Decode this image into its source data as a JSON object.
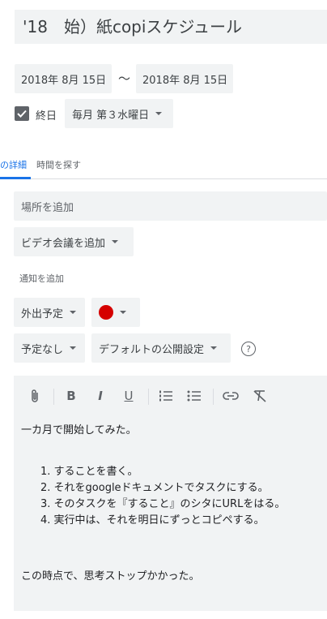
{
  "event": {
    "title": "'18　始）紙copiスケジュール",
    "start_date": "2018年 8月 15日",
    "date_separator": "〜",
    "end_date": "2018年 8月 15日",
    "all_day_label": "終日",
    "all_day_checked": true,
    "recurrence": "毎月 第３水曜日"
  },
  "tabs": [
    {
      "label": "の詳細",
      "active": true
    },
    {
      "label": "時間を探す",
      "active": false
    }
  ],
  "details": {
    "location_placeholder": "場所を追加",
    "video_conference": "ビデオ会議を追加",
    "add_notification": "通知を追加",
    "availability": "外出予定",
    "color": "#d50000",
    "reminder": "予定なし",
    "visibility": "デフォルトの公開設定",
    "help_glyph": "?"
  },
  "toolbar": {
    "attach_icon": "attachment-icon",
    "bold_label": "B",
    "italic_label": "I",
    "underline_label": "U",
    "numbered_list_icon": "numbered-list-icon",
    "bulleted_list_icon": "bulleted-list-icon",
    "link_icon": "link-icon",
    "clear_format_icon": "clear-formatting-icon"
  },
  "description": {
    "intro": "一カ月で開始してみた。",
    "items": [
      "1. することを書く。",
      "2. それをgoogleドキュメントでタスクにする。",
      "3. そのタスクを『すること』のシタにURLをはる。",
      "4. 実行中は、それを明日にずっとコピペする。"
    ],
    "outro": "この時点で、思考ストップかかった。"
  }
}
